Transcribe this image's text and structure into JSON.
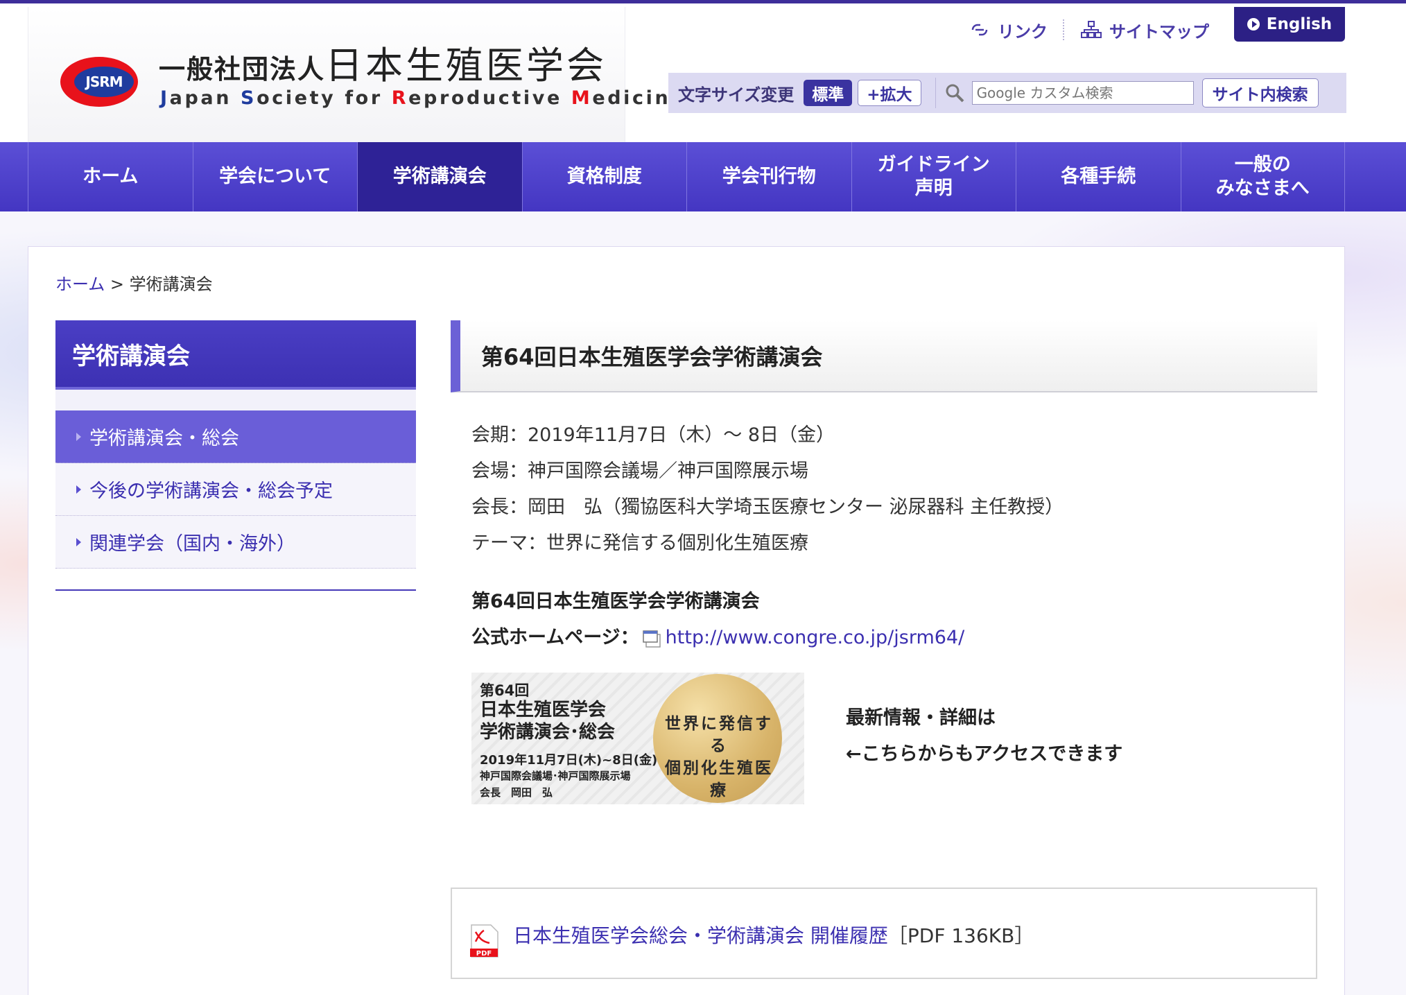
{
  "header": {
    "logo_mark_text": "JSRM",
    "logo_prefix": "一般社団法人",
    "logo_name": "日本生殖医学会",
    "logo_en": [
      "J",
      "apan ",
      "S",
      "ociety for ",
      "R",
      "eproductive ",
      "M",
      "edicine"
    ],
    "links_label": "リンク",
    "sitemap_label": "サイトマップ",
    "english_label": "English",
    "font_size_label": "文字サイズ変更",
    "size_standard": "標準",
    "size_large": "+拡大",
    "search_placeholder": "Google カスタム検索",
    "search_button": "サイト内検索"
  },
  "nav": {
    "items": [
      {
        "label": "ホーム"
      },
      {
        "label": "学会について"
      },
      {
        "label": "学術講演会"
      },
      {
        "label": "資格制度"
      },
      {
        "label": "学会刊行物"
      },
      {
        "label": "ガイドライン\n声明"
      },
      {
        "label": "各種手続"
      },
      {
        "label": "一般の\nみなさまへ"
      }
    ],
    "current_index": 2
  },
  "breadcrumb": {
    "home": "ホーム",
    "separator": ">",
    "current": "学術講演会"
  },
  "sidebar": {
    "title": "学術講演会",
    "items": [
      {
        "label": "学術講演会・総会"
      },
      {
        "label": "今後の学術講演会・総会予定"
      },
      {
        "label": "関連学会（国内・海外）"
      }
    ]
  },
  "main": {
    "title": "第64回日本生殖医学会学術講演会",
    "info": [
      "会期：2019年11月7日（木）～ 8日（金）",
      "会場：神戸国際会議場／神戸国際展示場",
      "会長：岡田　弘（獨協医科大学埼玉医療センター 泌尿器科 主任教授）",
      "テーマ：世界に発信する個別化生殖医療"
    ],
    "official_title": "第64回日本生殖医学会学術講演会",
    "official_label": "公式ホームページ：",
    "official_url": "http://www.congre.co.jp/jsrm64/",
    "banner": {
      "line1": "第64回",
      "line2": "日本生殖医学会",
      "line3": "学術講演会･総会",
      "line4": "2019年11月7日(木)~8日(金)",
      "line5": "神戸国際会議場･神戸国際展示場",
      "line6": "会長　岡田　弘",
      "theme1": "世界に発信する",
      "theme2": "個別化生殖医療"
    },
    "note1": "最新情報・詳細は",
    "note2": "←こちらからもアクセスできます",
    "pdf_link": "日本生殖医学会総会・学術講演会 開催履歴",
    "pdf_size": "［PDF 136KB］"
  }
}
